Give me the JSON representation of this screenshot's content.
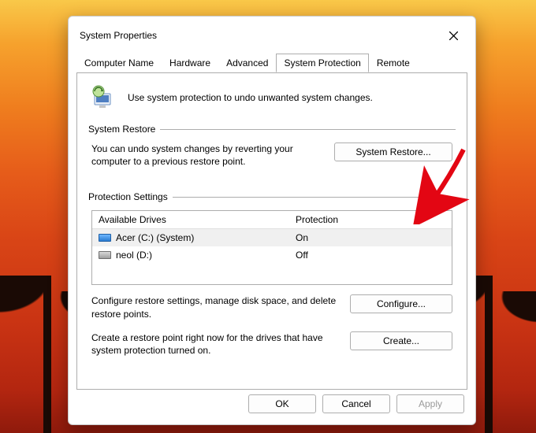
{
  "window": {
    "title": "System Properties"
  },
  "tabs": {
    "computer_name": "Computer Name",
    "hardware": "Hardware",
    "advanced": "Advanced",
    "system_protection": "System Protection",
    "remote": "Remote"
  },
  "intro": {
    "text": "Use system protection to undo unwanted system changes."
  },
  "restore": {
    "group_label": "System Restore",
    "text": "You can undo system changes by reverting your computer to a previous restore point.",
    "button": "System Restore..."
  },
  "protection": {
    "group_label": "Protection Settings",
    "header_drive": "Available Drives",
    "header_prot": "Protection",
    "rows": [
      {
        "name": "Acer (C:) (System)",
        "status": "On"
      },
      {
        "name": "neol (D:)",
        "status": "Off"
      }
    ],
    "configure_text": "Configure restore settings, manage disk space, and delete restore points.",
    "configure_btn": "Configure...",
    "create_text": "Create a restore point right now for the drives that have system protection turned on.",
    "create_btn": "Create..."
  },
  "footer": {
    "ok": "OK",
    "cancel": "Cancel",
    "apply": "Apply"
  }
}
